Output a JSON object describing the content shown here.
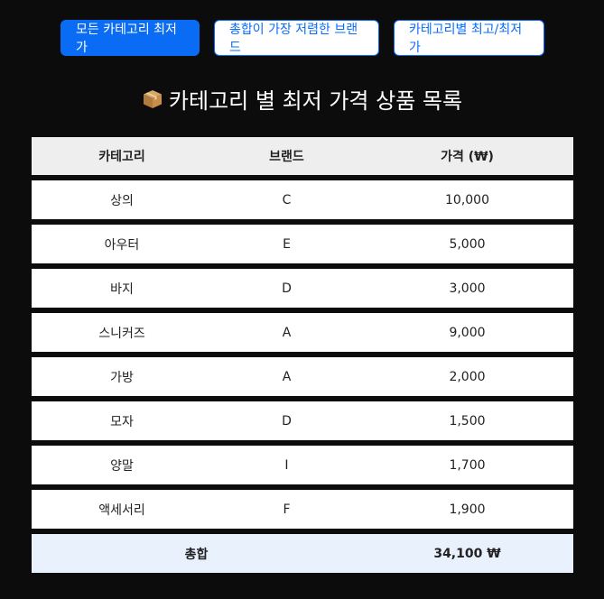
{
  "tabs": [
    {
      "label": "모든 카테고리 최저가",
      "active": true
    },
    {
      "label": "총합이 가장 저렴한 브랜드",
      "active": false
    },
    {
      "label": "카테고리별 최고/최저가",
      "active": false
    }
  ],
  "title": {
    "icon": "package-icon",
    "text": "카테고리 별 최저 가격 상품 목록"
  },
  "table": {
    "headers": {
      "category": "카테고리",
      "brand": "브랜드",
      "price": "가격 (₩)"
    },
    "rows": [
      {
        "category": "상의",
        "brand": "C",
        "price": "10,000"
      },
      {
        "category": "아우터",
        "brand": "E",
        "price": "5,000"
      },
      {
        "category": "바지",
        "brand": "D",
        "price": "3,000"
      },
      {
        "category": "스니커즈",
        "brand": "A",
        "price": "9,000"
      },
      {
        "category": "가방",
        "brand": "A",
        "price": "2,000"
      },
      {
        "category": "모자",
        "brand": "D",
        "price": "1,500"
      },
      {
        "category": "양말",
        "brand": "I",
        "price": "1,700"
      },
      {
        "category": "액세서리",
        "brand": "F",
        "price": "1,900"
      }
    ],
    "total": {
      "label": "총합",
      "value": "34,100 ₩"
    }
  },
  "colors": {
    "background": "#0c0c0c",
    "accent": "#0a6cf5",
    "header_bg": "#eeeeee",
    "total_bg": "#e8f1fc"
  }
}
